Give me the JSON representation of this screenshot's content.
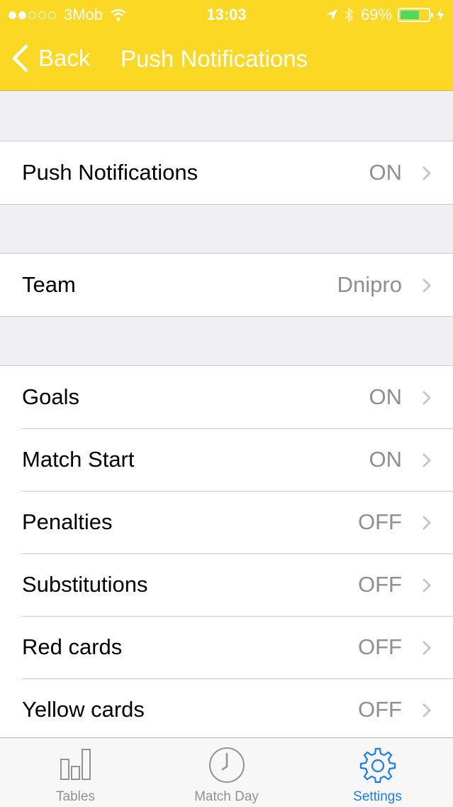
{
  "status_bar": {
    "carrier": "3Mob",
    "time": "13:03",
    "battery": "69%",
    "battery_level": 0.69,
    "signal_bars_filled": 2,
    "signal_bars_total": 5
  },
  "nav": {
    "back_label": "Back",
    "title": "Push Notifications"
  },
  "groups": {
    "master": [
      {
        "label": "Push Notifications",
        "value": "ON"
      }
    ],
    "team": [
      {
        "label": "Team",
        "value": "Dnipro"
      }
    ],
    "events": [
      {
        "label": "Goals",
        "value": "ON"
      },
      {
        "label": "Match Start",
        "value": "ON"
      },
      {
        "label": "Penalties",
        "value": "OFF"
      },
      {
        "label": "Substitutions",
        "value": "OFF"
      },
      {
        "label": "Red cards",
        "value": "OFF"
      },
      {
        "label": "Yellow cards",
        "value": "OFF"
      }
    ]
  },
  "tabbar": {
    "tabs": [
      {
        "label": "Tables",
        "icon": "bar-chart-icon",
        "active": false
      },
      {
        "label": "Match Day",
        "icon": "clock-icon",
        "active": false
      },
      {
        "label": "Settings",
        "icon": "gear-icon",
        "active": true
      }
    ]
  },
  "colors": {
    "header": "#fbd824",
    "accent": "#1a7cf4",
    "battery": "#4cd964"
  }
}
